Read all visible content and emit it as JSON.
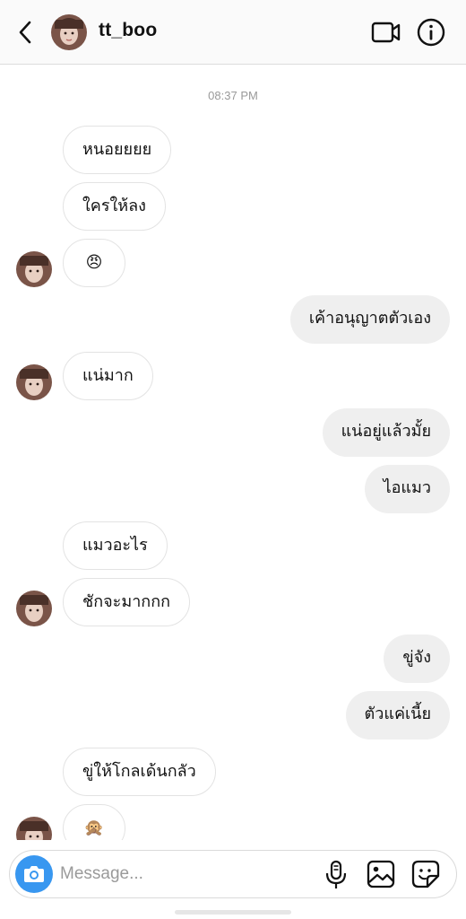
{
  "header": {
    "username": "tt_boo"
  },
  "timestamp": "08:37 PM",
  "messages": [
    {
      "text": "หนอยยยย",
      "side": "in"
    },
    {
      "text": "ใครให้ลง",
      "side": "in"
    },
    {
      "text": "😠",
      "side": "in"
    },
    {
      "text": "เค้าอนุญาตตัวเอง",
      "side": "out"
    },
    {
      "text": "แน่มาก",
      "side": "in"
    },
    {
      "text": "แน่อยู่แล้วมั้ย",
      "side": "out"
    },
    {
      "text": "ไอแมว",
      "side": "out"
    },
    {
      "text": "แมวอะไร",
      "side": "in"
    },
    {
      "text": "ชักจะมากกก",
      "side": "in"
    },
    {
      "text": "ขู่จัง",
      "side": "out"
    },
    {
      "text": "ตัวแค่เนี้ย",
      "side": "out"
    },
    {
      "text": "ขู่ให้โกลเด้นกลัว",
      "side": "in"
    },
    {
      "text": "🙊",
      "side": "in"
    }
  ],
  "composer": {
    "placeholder": "Message..."
  },
  "icons": {
    "back": "chevron-left-icon",
    "video": "video-camera-icon",
    "info": "info-icon",
    "camera": "camera-icon",
    "mic": "microphone-icon",
    "gallery": "image-icon",
    "sticker": "sticker-icon"
  },
  "colors": {
    "accent": "#3897f0",
    "incoming_border": "#e3e3e3",
    "outgoing_bg": "#efefef",
    "header_bg": "#fafafa"
  }
}
